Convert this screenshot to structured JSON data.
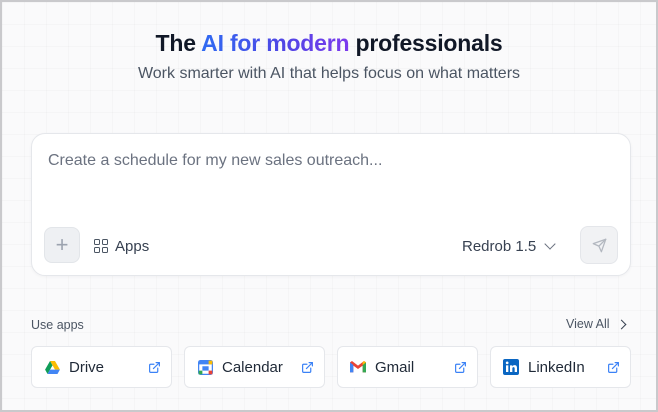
{
  "hero": {
    "title_before": "The ",
    "title_highlight": "AI for modern",
    "title_after": " professionals",
    "subtitle": "Work smarter with AI that helps focus on what matters"
  },
  "composer": {
    "placeholder": "Create a schedule for my new sales outreach...",
    "add_label": "+",
    "apps_label": "Apps",
    "model_label": "Redrob 1.5"
  },
  "apps_section": {
    "label": "Use apps",
    "view_all": "View All",
    "apps": [
      {
        "name": "Drive",
        "icon": "google-drive-icon"
      },
      {
        "name": "Calendar",
        "icon": "google-calendar-icon"
      },
      {
        "name": "Gmail",
        "icon": "gmail-icon"
      },
      {
        "name": "LinkedIn",
        "icon": "linkedin-icon"
      }
    ]
  },
  "colors": {
    "accent_start": "#2f6bf2",
    "accent_end": "#7c3aed",
    "linkedin": "#0a66c2",
    "external_link": "#3b82f6"
  }
}
